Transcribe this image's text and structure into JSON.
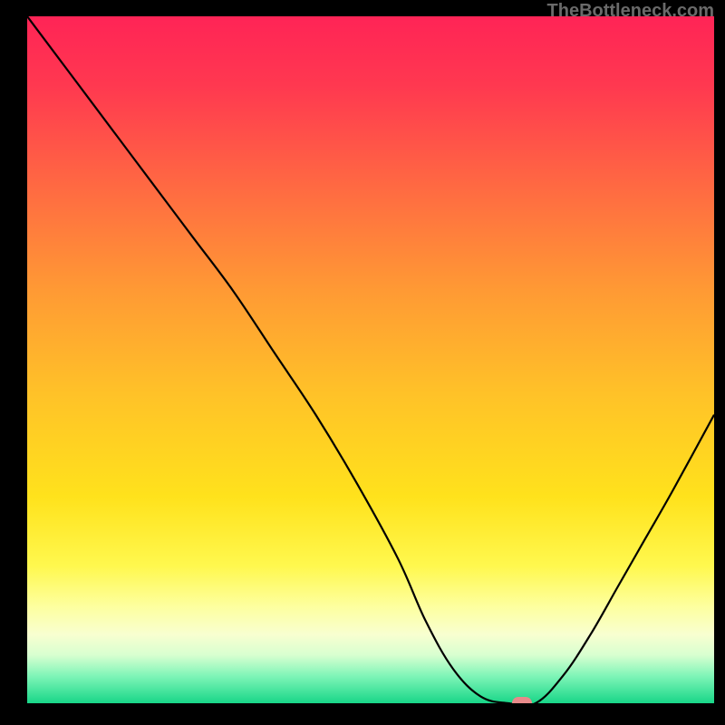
{
  "watermark": "TheBottleneck.com",
  "chart_data": {
    "type": "line",
    "title": "",
    "xlabel": "",
    "ylabel": "",
    "xlim": [
      0,
      100
    ],
    "ylim": [
      0,
      100
    ],
    "x": [
      0,
      6,
      12,
      18,
      24,
      30,
      36,
      42,
      48,
      54,
      58,
      62,
      66,
      70,
      74,
      78,
      82,
      86,
      90,
      94,
      100
    ],
    "y": [
      100,
      92,
      84,
      76,
      68,
      60,
      51,
      42,
      32,
      21,
      12,
      5,
      1,
      0,
      0,
      4,
      10,
      17,
      24,
      31,
      42
    ],
    "marker": {
      "x": 72,
      "y": 0,
      "shape": "pill",
      "color": "#e88a8a"
    },
    "background": {
      "type": "vertical-gradient",
      "stops": [
        {
          "pos": 0.0,
          "color": "#ff2456"
        },
        {
          "pos": 0.1,
          "color": "#ff3850"
        },
        {
          "pos": 0.25,
          "color": "#ff6a42"
        },
        {
          "pos": 0.4,
          "color": "#ff9a34"
        },
        {
          "pos": 0.55,
          "color": "#ffc228"
        },
        {
          "pos": 0.7,
          "color": "#ffe21c"
        },
        {
          "pos": 0.8,
          "color": "#fff84e"
        },
        {
          "pos": 0.86,
          "color": "#fdffa0"
        },
        {
          "pos": 0.9,
          "color": "#f8ffd0"
        },
        {
          "pos": 0.93,
          "color": "#d8ffd0"
        },
        {
          "pos": 0.96,
          "color": "#80f5b8"
        },
        {
          "pos": 1.0,
          "color": "#18d688"
        }
      ]
    }
  }
}
